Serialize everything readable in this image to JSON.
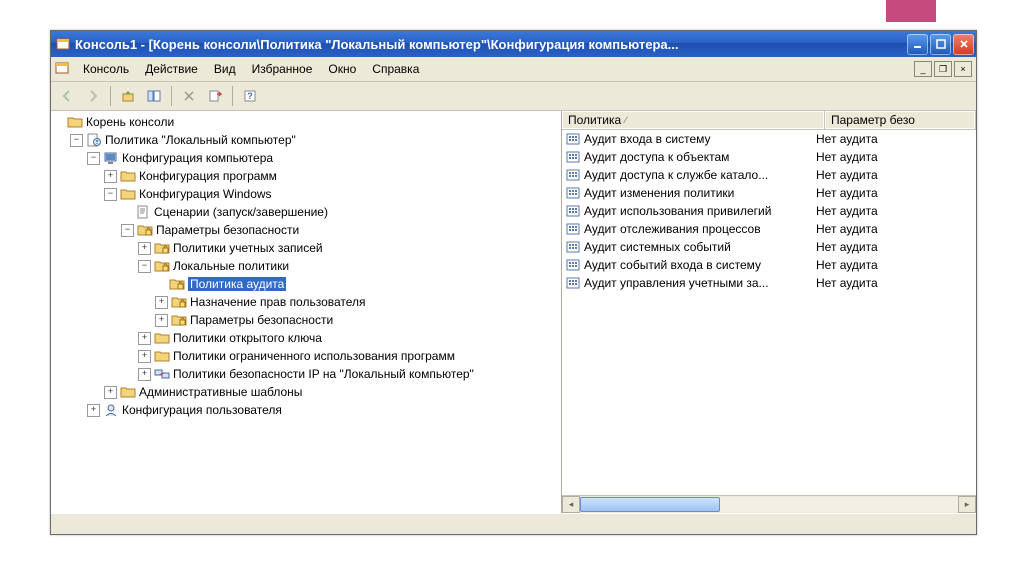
{
  "window": {
    "title": "Консоль1 - [Корень консоли\\Политика \"Локальный компьютер\"\\Конфигурация компьютера..."
  },
  "menu": {
    "items": [
      "Консоль",
      "Действие",
      "Вид",
      "Избранное",
      "Окно",
      "Справка"
    ]
  },
  "tree": [
    {
      "depth": 0,
      "exp": "",
      "icon": "folder",
      "label": "Корень консоли"
    },
    {
      "depth": 1,
      "exp": "-",
      "icon": "policy",
      "label": "Политика \"Локальный компьютер\""
    },
    {
      "depth": 2,
      "exp": "-",
      "icon": "computer",
      "label": "Конфигурация компьютера"
    },
    {
      "depth": 3,
      "exp": "+",
      "icon": "folder",
      "label": "Конфигурация программ"
    },
    {
      "depth": 3,
      "exp": "-",
      "icon": "folder",
      "label": "Конфигурация Windows"
    },
    {
      "depth": 4,
      "exp": "",
      "icon": "script",
      "label": "Сценарии (запуск/завершение)"
    },
    {
      "depth": 4,
      "exp": "-",
      "icon": "lockfolder",
      "label": "Параметры безопасности"
    },
    {
      "depth": 5,
      "exp": "+",
      "icon": "lockfolder",
      "label": "Политики учетных записей"
    },
    {
      "depth": 5,
      "exp": "-",
      "icon": "lockfolder",
      "label": "Локальные политики"
    },
    {
      "depth": 6,
      "exp": "",
      "icon": "lockfolder",
      "label": "Политика аудита",
      "selected": true
    },
    {
      "depth": 6,
      "exp": "+",
      "icon": "lockfolder",
      "label": "Назначение прав пользователя"
    },
    {
      "depth": 6,
      "exp": "+",
      "icon": "lockfolder",
      "label": "Параметры безопасности"
    },
    {
      "depth": 5,
      "exp": "+",
      "icon": "folder",
      "label": "Политики открытого ключа"
    },
    {
      "depth": 5,
      "exp": "+",
      "icon": "folder",
      "label": "Политики ограниченного использования программ"
    },
    {
      "depth": 5,
      "exp": "+",
      "icon": "ipsec",
      "label": "Политики безопасности IP на \"Локальный компьютер\""
    },
    {
      "depth": 3,
      "exp": "+",
      "icon": "folder",
      "label": "Административные шаблоны"
    },
    {
      "depth": 2,
      "exp": "+",
      "icon": "user",
      "label": "Конфигурация пользователя"
    }
  ],
  "list": {
    "columns": {
      "policy": "Политика",
      "param": "Параметр безо"
    },
    "rows": [
      {
        "policy": "Аудит входа в систему",
        "param": "Нет аудита"
      },
      {
        "policy": "Аудит доступа к объектам",
        "param": "Нет аудита"
      },
      {
        "policy": "Аудит доступа к службе катало...",
        "param": "Нет аудита"
      },
      {
        "policy": "Аудит изменения политики",
        "param": "Нет аудита"
      },
      {
        "policy": "Аудит использования привилегий",
        "param": "Нет аудита"
      },
      {
        "policy": "Аудит отслеживания процессов",
        "param": "Нет аудита"
      },
      {
        "policy": "Аудит системных событий",
        "param": "Нет аудита"
      },
      {
        "policy": "Аудит событий входа в систему",
        "param": "Нет аудита"
      },
      {
        "policy": "Аудит управления учетными за...",
        "param": "Нет аудита"
      }
    ]
  }
}
